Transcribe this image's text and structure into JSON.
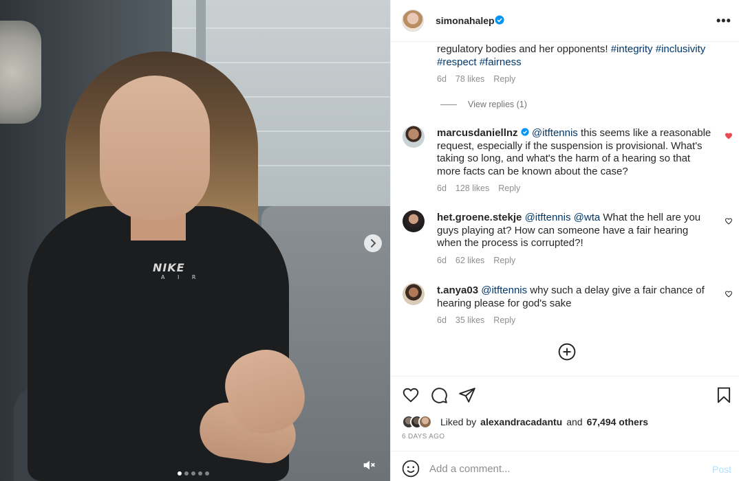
{
  "media": {
    "shirt_brand": "NIKE",
    "shirt_sub": "A I R",
    "carousel_dots": 5,
    "active_dot": 0
  },
  "post": {
    "username": "simonahalep",
    "verified": true
  },
  "comments": [
    {
      "text_parts": [
        {
          "t": "regulatory bodies and her opponents! ",
          "tag": false
        },
        {
          "t": "#integrity",
          "tag": true
        },
        {
          "t": " ",
          "tag": false
        },
        {
          "t": "#inclusivity",
          "tag": true
        },
        {
          "t": " ",
          "tag": false
        },
        {
          "t": "#respect",
          "tag": true
        },
        {
          "t": " ",
          "tag": false
        },
        {
          "t": "#fairness",
          "tag": true
        }
      ],
      "age": "6d",
      "likes": "78 likes",
      "reply": "Reply"
    },
    {
      "username": "marcusdaniellnz",
      "verified": true,
      "mention": "@itftennis",
      "body": " this seems like a reasonable request, especially if the suspension is provisional. What's taking so long, and what's the harm of a hearing so that more facts can be known about the case?",
      "age": "6d",
      "likes": "128 likes",
      "reply": "Reply",
      "liked": true
    },
    {
      "username": "het.groene.stekje",
      "mention": "@itftennis",
      "mention2": "@wta",
      "body": " What the hell are you guys playing at? How can someone have a fair hearing when the process is corrupted?!",
      "age": "6d",
      "likes": "62 likes",
      "reply": "Reply",
      "liked": false
    },
    {
      "username": "t.anya03",
      "mention": "@itftennis",
      "body": " why such a delay give a fair chance of hearing please for god's sake",
      "age": "6d",
      "likes": "35 likes",
      "reply": "Reply",
      "liked": false
    }
  ],
  "view_replies": "View replies (1)",
  "liked_by": {
    "prefix": "Liked by",
    "user": "alexandracadantu",
    "and": "and",
    "others": "67,494 others"
  },
  "date": "6 DAYS AGO",
  "composer": {
    "placeholder": "Add a comment...",
    "post_label": "Post"
  },
  "colors": {
    "tag": "#00376b",
    "heart_red": "#ed4956",
    "verified_blue": "#0095f6",
    "post_disabled": "#b2dffc"
  }
}
